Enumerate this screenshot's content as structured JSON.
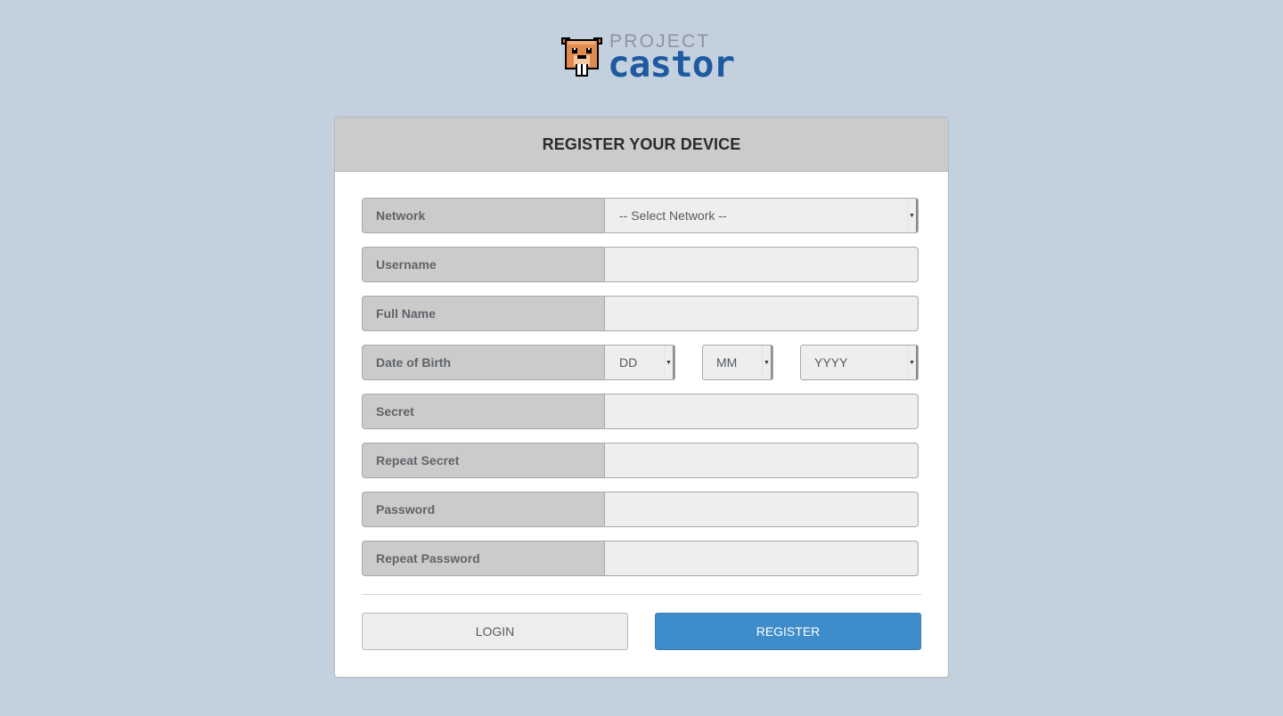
{
  "logo": {
    "top_text": "PROJECT",
    "bottom_text": "castor",
    "icon": "beaver-icon",
    "colors": {
      "top": "#8e959c",
      "bottom": "#1e5aa0"
    }
  },
  "form": {
    "title": "REGISTER YOUR DEVICE",
    "fields": {
      "network": {
        "label": "Network",
        "selected": "-- Select Network --"
      },
      "username": {
        "label": "Username",
        "value": ""
      },
      "full_name": {
        "label": "Full Name",
        "value": ""
      },
      "dob": {
        "label": "Date of Birth",
        "day": "DD",
        "month": "MM",
        "year": "YYYY"
      },
      "secret": {
        "label": "Secret",
        "value": ""
      },
      "repeat_secret": {
        "label": "Repeat Secret",
        "value": ""
      },
      "password": {
        "label": "Password",
        "value": ""
      },
      "repeat_password": {
        "label": "Repeat Password",
        "value": ""
      }
    },
    "buttons": {
      "login": "LOGIN",
      "register": "REGISTER"
    }
  },
  "colors": {
    "page_bg": "#c3d1df",
    "primary": "#3f8ccb",
    "label_bg": "#cbcbcb",
    "input_bg": "#eeeeee"
  }
}
